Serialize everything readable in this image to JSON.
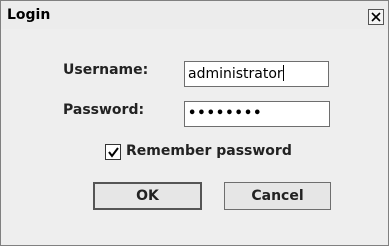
{
  "window": {
    "title": "Login"
  },
  "form": {
    "username_label": "Username:",
    "username_value": "administrator",
    "password_label": "Password:",
    "password_mask": "••••••••",
    "remember_label": "Remember password",
    "remember_checked": true
  },
  "buttons": {
    "ok_label": "OK",
    "cancel_label": "Cancel"
  }
}
